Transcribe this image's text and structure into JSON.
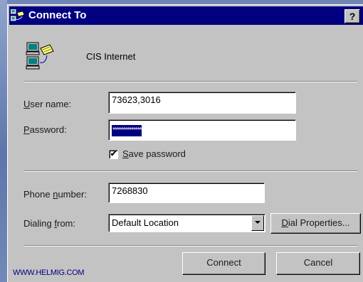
{
  "window": {
    "title": "Connect To",
    "help_label": "?"
  },
  "connection": {
    "name": "CIS Internet",
    "icon": "dial-up-networking-icon"
  },
  "form": {
    "username": {
      "label_accel": "U",
      "label_rest": "ser name:",
      "value": "73623,3016"
    },
    "password": {
      "label_accel": "P",
      "label_rest": "assword:",
      "mask": "**************"
    },
    "save_password": {
      "label_accel": "S",
      "label_rest": "ave password",
      "checked": true,
      "check_glyph": "✔"
    },
    "phone": {
      "label_pre": "Phone ",
      "label_accel": "n",
      "label_rest": "umber:",
      "value": "7268830"
    },
    "dialing": {
      "label_pre": "Dialing ",
      "label_accel": "f",
      "label_rest": "rom:",
      "value": "Default Location"
    }
  },
  "buttons": {
    "dial_properties": {
      "accel": "D",
      "rest": "ial Properties..."
    },
    "connect": "Connect",
    "cancel": "Cancel"
  },
  "watermark": "WWW.HELMIG.COM",
  "colors": {
    "titlebar": "#010080",
    "dialog_face": "#c3c3c3",
    "desktop": "#6f86b6"
  }
}
